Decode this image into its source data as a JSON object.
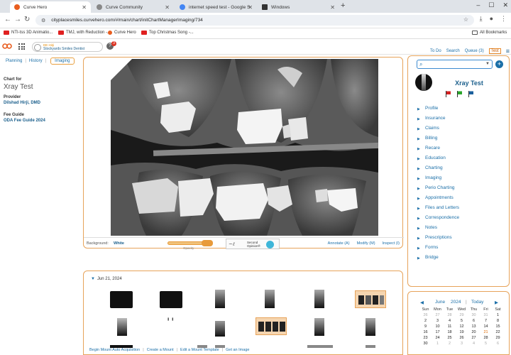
{
  "browser": {
    "tabs": [
      {
        "title": "Curve Hero",
        "active": true,
        "fav_color": "#e85d1f"
      },
      {
        "title": "Curve Community",
        "active": false,
        "fav_color": "#666666"
      },
      {
        "title": "internet speed test - Google S",
        "active": false,
        "fav_color": "#4285f4"
      },
      {
        "title": "Windows",
        "active": false,
        "fav_color": "#333333"
      }
    ],
    "url": "cityplacesmiles.curvehero.com/#/main/chart/initChartManagerImaging/734",
    "bookmarks": [
      {
        "label": "NTI-tss 3D Animatio...",
        "color": "#e02020"
      },
      {
        "label": "TMJ, with Reduction -...",
        "color": "#e02020"
      },
      {
        "label": "Curve Hero",
        "color": "#e85d1f"
      },
      {
        "label": "Top Christmas Song -...",
        "color": "#e02020"
      }
    ],
    "all_bookmarks": "All Bookmarks"
  },
  "app": {
    "office_line1": "DE Hirji",
    "office_line2": "Stockyards Smiles Dentist",
    "help_badge": "3",
    "topnav": {
      "todo": "To Do",
      "search": "Search",
      "queue": "Queue (3)",
      "test": "Test"
    }
  },
  "left": {
    "tabs": [
      "Planning",
      "History",
      "Imaging"
    ],
    "chart_for_label": "Chart for",
    "chart_for_value": "Xray Test",
    "provider_label": "Provider",
    "provider_value": "Dilshad Hirji, DMD",
    "fee_guide_label": "Fee Guide",
    "fee_guide_value": "ODA Fee Guide 2024"
  },
  "imaging": {
    "background_label": "Background:",
    "background_value": "White",
    "opacity_label": "Opacity",
    "second_opinion": "Second\nOpinion®",
    "links": [
      "Annotate (A)",
      "Modify (M)",
      "Inspect (I)"
    ]
  },
  "thumbnails": {
    "date": "Jun 21, 2024",
    "links": [
      "Begin Mount Auto Acquisition",
      "Create a Mount",
      "Edit a Mount Template",
      "Get an Image"
    ]
  },
  "patient": {
    "name": "Xray Test",
    "flags": [
      "#d42020",
      "#2aa52a",
      "#1b5f9c"
    ],
    "menu": [
      "Profile",
      "Insurance",
      "Claims",
      "Billing",
      "Recare",
      "Education",
      "Charting",
      "Imaging",
      "Perio Charting",
      "Appointments",
      "Files and Letters",
      "Correspondence",
      "Notes",
      "Prescriptions",
      "Forms",
      "Bridge"
    ]
  },
  "calendar": {
    "month": "June",
    "year": "2024",
    "today_label": "Today",
    "days_of_week": [
      "Sun",
      "Mon",
      "Tue",
      "Wed",
      "Thu",
      "Fri",
      "Sat"
    ],
    "weeks": [
      [
        "26",
        "27",
        "28",
        "29",
        "30",
        "31",
        "1"
      ],
      [
        "2",
        "3",
        "4",
        "5",
        "6",
        "7",
        "8"
      ],
      [
        "9",
        "10",
        "11",
        "12",
        "13",
        "14",
        "15"
      ],
      [
        "16",
        "17",
        "18",
        "19",
        "20",
        "21",
        "22"
      ],
      [
        "23",
        "24",
        "25",
        "26",
        "27",
        "28",
        "29"
      ],
      [
        "30",
        "1",
        "2",
        "3",
        "4",
        "5",
        "6"
      ]
    ],
    "today": "21"
  },
  "colors": {
    "accent": "#e7a35a",
    "link": "#1b6fa8",
    "brand": "#e85d1f"
  }
}
